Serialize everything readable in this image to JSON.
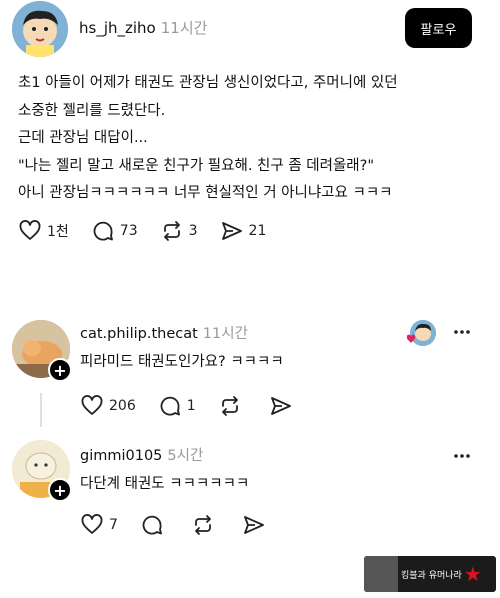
{
  "post": {
    "username": "hs_jh_ziho",
    "timestamp": "11시간",
    "follow_label": "팔로우",
    "body_lines": [
      "초1 아들이 어제가 태권도 관장님 생신이었다고, 주머니에 있던",
      "소중한 젤리를 드렸단다.",
      "근데 관장님 대답이...",
      "\"나는 젤리 말고 새로운 친구가 필요해. 친구 좀 데려올래?\"",
      "아니 관장님ㅋㅋㅋㅋㅋㅋ 너무 현실적인 거 아니냐고요 ㅋㅋㅋ"
    ],
    "likes": "1천",
    "comments": "73",
    "reposts": "3",
    "shares": "21"
  },
  "comments": [
    {
      "username": "cat.philip.thecat",
      "timestamp": "11시간",
      "text": "피라미드 태권도인가요? ㅋㅋㅋㅋ",
      "likes": "206",
      "replies": "1"
    },
    {
      "username": "gimmi0105",
      "timestamp": "5시간",
      "text": "다단계 태권도 ㅋㅋㅋㅋㅋㅋ",
      "likes": "7"
    }
  ],
  "watermark": {
    "text": "킹블과 유머나라"
  },
  "colors": {
    "accent": "#000000",
    "muted": "#999999",
    "heart": "#e0245e"
  }
}
